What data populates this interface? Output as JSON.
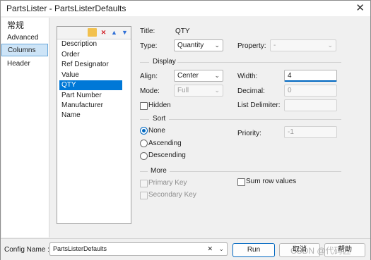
{
  "window": {
    "title": "PartsLister - PartsListerDefaults",
    "close_glyph": "✕"
  },
  "sidebar": {
    "items": [
      {
        "label": "常规"
      },
      {
        "label": "Advanced"
      },
      {
        "label": "Columns"
      },
      {
        "label": "Header"
      }
    ],
    "selected": "Columns"
  },
  "columns_list": {
    "toolbar_icons": [
      "folder-icon",
      "delete-icon",
      "move-up-icon",
      "move-down-icon"
    ],
    "items": [
      "Description",
      "Order",
      "Ref Designator",
      "Value",
      "QTY",
      "Part Number",
      "Manufacturer Name"
    ],
    "selected": "QTY"
  },
  "props": {
    "title_label": "Title:",
    "title_value": "QTY",
    "type_label": "Type:",
    "type_value": "Quantity",
    "property_label": "Property:",
    "property_value": "-"
  },
  "display": {
    "group": "Display",
    "align_label": "Align:",
    "align_value": "Center",
    "width_label": "Width:",
    "width_value": "4",
    "mode_label": "Mode:",
    "mode_value": "Full",
    "decimal_label": "Decimal:",
    "decimal_value": "0",
    "hidden_label": "Hidden",
    "list_delimiter_label": "List Delimiter:",
    "list_delimiter_value": ""
  },
  "sort": {
    "group": "Sort",
    "none_label": "None",
    "ascending_label": "Ascending",
    "descending_label": "Descending",
    "selected": "None",
    "priority_label": "Priority:",
    "priority_value": "-1"
  },
  "more": {
    "group": "More",
    "primary_key_label": "Primary Key",
    "secondary_key_label": "Secondary Key",
    "sum_row_values_label": "Sum row values"
  },
  "footer": {
    "config_label": "Config Name :",
    "config_value": "PartsListerDefaults",
    "clear_glyph": "✕",
    "dropdown_glyph": "⌄",
    "run_label": "Run",
    "cancel_label": "取消",
    "help_label": "帮助"
  },
  "watermark": "CSDN @代码匠"
}
